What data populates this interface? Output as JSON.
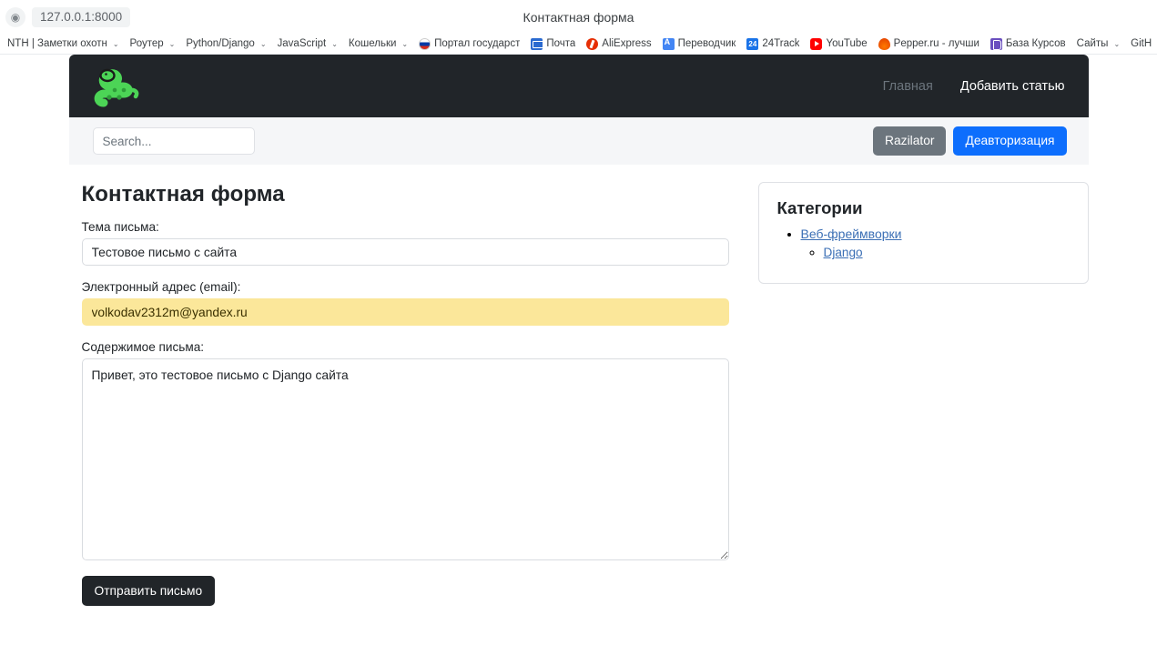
{
  "browser": {
    "site_icon": "globe-icon",
    "url": "127.0.0.1:8000",
    "tab_title": "Контактная форма",
    "bookmarks": [
      {
        "label": "NTH | Заметки охотн",
        "caret": "⌄",
        "favicon": "none"
      },
      {
        "label": "Роутер",
        "caret": "⌄",
        "favicon": "none"
      },
      {
        "label": "Python/Django",
        "caret": "⌄",
        "favicon": "none"
      },
      {
        "label": "JavaScript",
        "caret": "⌄",
        "favicon": "none"
      },
      {
        "label": "Кошельки",
        "caret": "⌄",
        "favicon": "none"
      },
      {
        "label": "Портал государст",
        "caret": "",
        "favicon": "ru-flag-icon"
      },
      {
        "label": "Почта",
        "caret": "",
        "favicon": "mail-icon"
      },
      {
        "label": "AliExpress",
        "caret": "",
        "favicon": "aliexpress-icon"
      },
      {
        "label": "Переводчик",
        "caret": "",
        "favicon": "translate-icon"
      },
      {
        "label": "24Track",
        "caret": "",
        "favicon": "24track-icon"
      },
      {
        "label": "YouTube",
        "caret": "",
        "favicon": "youtube-icon"
      },
      {
        "label": "Pepper.ru - лучши",
        "caret": "",
        "favicon": "pepper-icon"
      },
      {
        "label": "База Курсов",
        "caret": "",
        "favicon": "base-kursov-icon"
      },
      {
        "label": "Сайты",
        "caret": "⌄",
        "favicon": "none"
      },
      {
        "label": "GitH",
        "caret": "",
        "favicon": "none"
      }
    ]
  },
  "navbar": {
    "logo": "python-snake-logo",
    "links": [
      {
        "label": "Главная",
        "muted": true
      },
      {
        "label": "Добавить статью",
        "muted": false
      }
    ]
  },
  "subbar": {
    "search_placeholder": "Search...",
    "search_value": "",
    "buttons": [
      {
        "label": "Razilator",
        "style": "secondary"
      },
      {
        "label": "Деавторизация",
        "style": "primary"
      }
    ]
  },
  "form": {
    "title": "Контактная форма",
    "subject_label": "Тема письма:",
    "subject_value": "Тестовое письмо с сайта",
    "email_label": "Электронный адрес (email):",
    "email_value": "volkodav2312m@yandex.ru",
    "body_label": "Содержимое письма:",
    "body_value": "Привет, это тестовое письмо с Django сайта",
    "submit_label": "Отправить письмо"
  },
  "sidebar": {
    "title": "Категории",
    "categories": [
      {
        "label": "Веб-фреймворки",
        "children": [
          {
            "label": "Django"
          }
        ]
      }
    ]
  },
  "colors": {
    "navbar_bg": "#212529",
    "subbar_bg": "#f5f6f8",
    "primary": "#0d6efd",
    "secondary": "#6c757d",
    "autofill": "#fbe79a",
    "link": "#3b6fb5"
  }
}
